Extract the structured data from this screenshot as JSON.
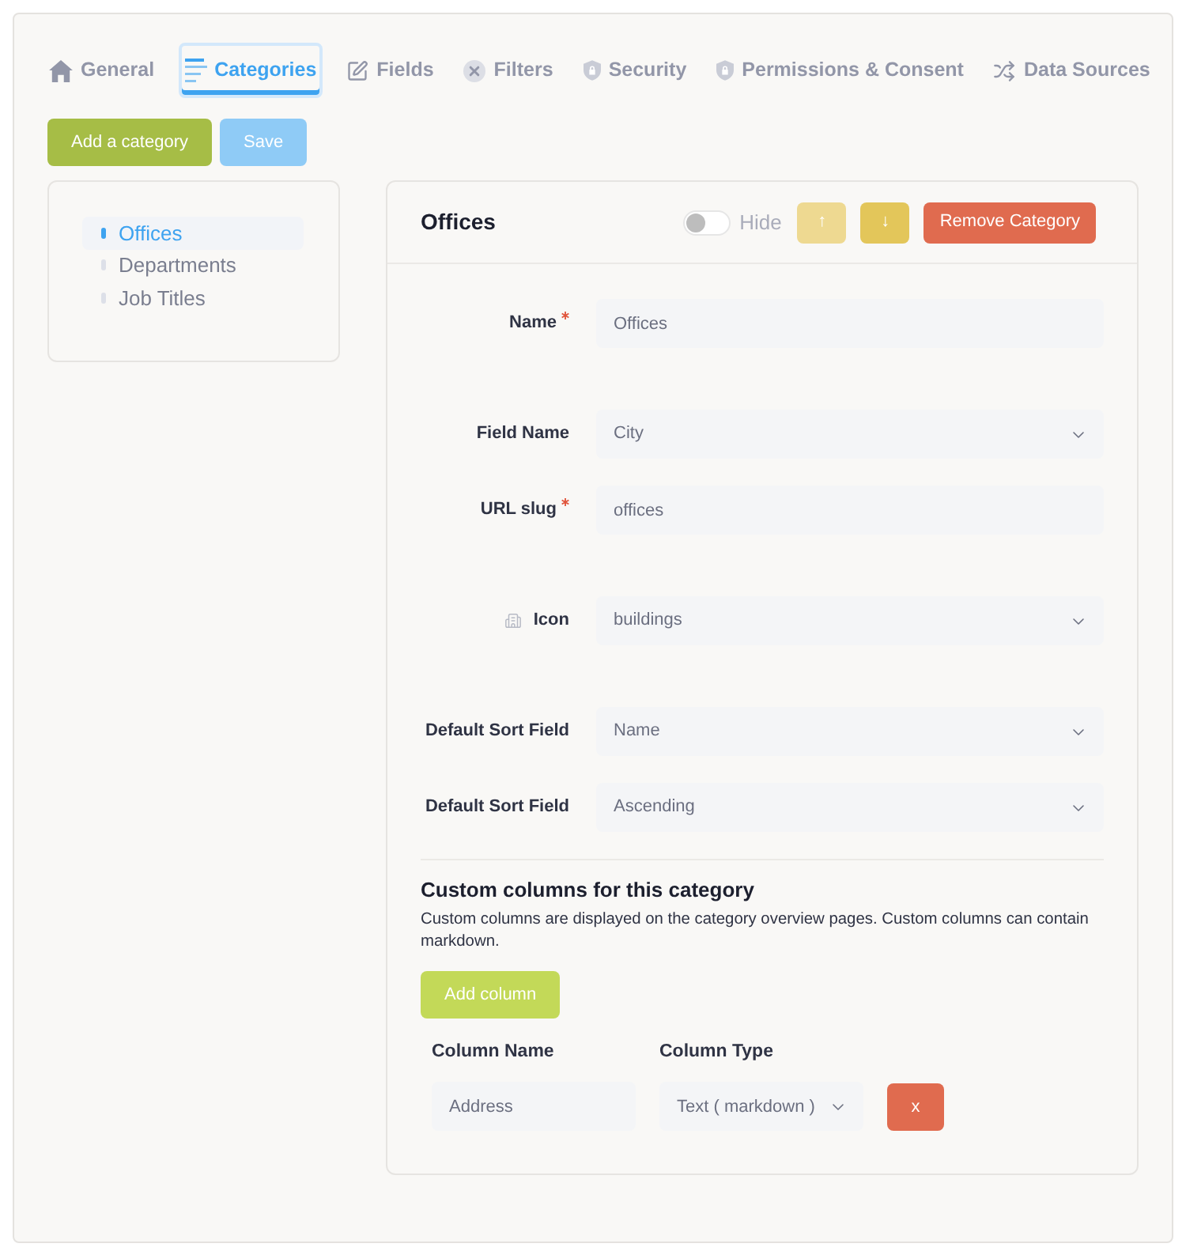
{
  "tabs": [
    {
      "label": "General",
      "selected": false
    },
    {
      "label": "Categories",
      "selected": true
    },
    {
      "label": "Fields",
      "selected": false
    },
    {
      "label": "Filters",
      "selected": false
    },
    {
      "label": "Security",
      "selected": false
    },
    {
      "label": "Permissions & Consent",
      "selected": false
    },
    {
      "label": "Data Sources",
      "selected": false
    }
  ],
  "toolbar": {
    "add_button": "Add a category",
    "save_button": {
      "label": "Save",
      "disabled": true
    }
  },
  "sidebar": {
    "items": [
      {
        "label": "Offices",
        "selected": true
      },
      {
        "label": "Departments",
        "selected": false
      },
      {
        "label": "Job Titles",
        "selected": false
      }
    ]
  },
  "editor": {
    "title": "Offices",
    "hide_toggle": {
      "label": "Hide",
      "on": false
    },
    "move_buttons": [
      {
        "label": "↑",
        "disabled": true
      },
      {
        "label": "↓",
        "disabled": false
      }
    ],
    "remove_button": "Remove Category",
    "fields": [
      {
        "kind": "text",
        "label": "Name",
        "required": true,
        "value": "Offices"
      },
      {
        "kind": "select",
        "label": "Field Name",
        "required": false,
        "value": "City"
      },
      {
        "kind": "text",
        "label": "URL slug",
        "required": true,
        "value": "offices"
      },
      {
        "kind": "icon_select",
        "label": "Icon",
        "required": false,
        "value": "buildings"
      },
      {
        "kind": "select",
        "label": "Default Sort Field",
        "required": false,
        "value": "Name"
      },
      {
        "kind": "select",
        "label": "Default Sort Field",
        "required": false,
        "value": "Ascending"
      }
    ],
    "custom_columns": {
      "title": "Custom columns for this category",
      "description": "Custom columns are displayed on the category overview pages. Custom columns can contain markdown.",
      "add_button": "Add column",
      "headers": [
        "Column Name",
        "Column Type"
      ],
      "rows": [
        {
          "name": "Address",
          "type": "Text ( markdown )",
          "remove_button": "x"
        }
      ]
    }
  }
}
